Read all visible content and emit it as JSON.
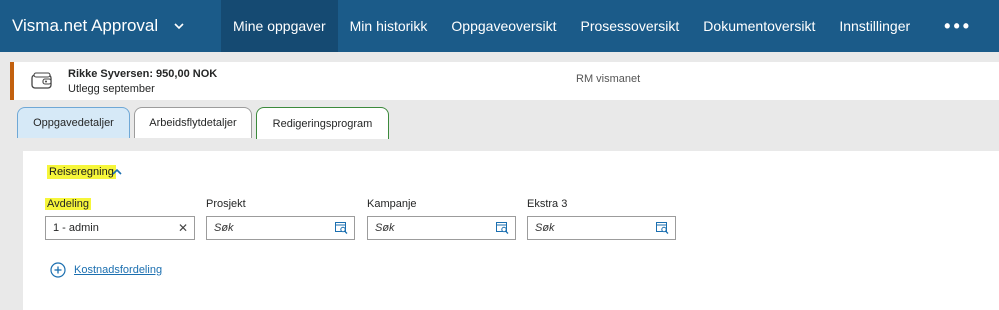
{
  "app": {
    "title": "Visma.net Approval",
    "brand_color": "#1b5b89"
  },
  "nav": {
    "items": [
      {
        "label": "Mine oppgaver",
        "active": true
      },
      {
        "label": "Min historikk"
      },
      {
        "label": "Oppgaveoversikt"
      },
      {
        "label": "Prosessoversikt"
      },
      {
        "label": "Dokumentoversikt"
      },
      {
        "label": "Innstillinger"
      }
    ],
    "more_label": "•••"
  },
  "task": {
    "title": "Rikke Syversen: 950,00 NOK",
    "subtitle": "Utlegg september",
    "company": "RM vismanet",
    "icon": "wallet-icon",
    "accent_color": "#c2600e"
  },
  "tabs": [
    {
      "label": "Oppgavedetaljer",
      "active": true
    },
    {
      "label": "Arbeidsflytdetaljer"
    },
    {
      "label": "Redigeringsprogram",
      "highlighted": true
    }
  ],
  "section": {
    "title": "Reiseregning",
    "expanded": true
  },
  "fields": [
    {
      "label": "Avdeling",
      "value": "1 - admin",
      "placeholder": "",
      "clearable": true
    },
    {
      "label": "Prosjekt",
      "value": "",
      "placeholder": "Søk"
    },
    {
      "label": "Kampanje",
      "value": "",
      "placeholder": "Søk"
    },
    {
      "label": "Ekstra 3",
      "value": "",
      "placeholder": "Søk"
    }
  ],
  "cost_distribution": {
    "label": "Kostnadsfordeling"
  },
  "highlight_color": "#f6f63a"
}
